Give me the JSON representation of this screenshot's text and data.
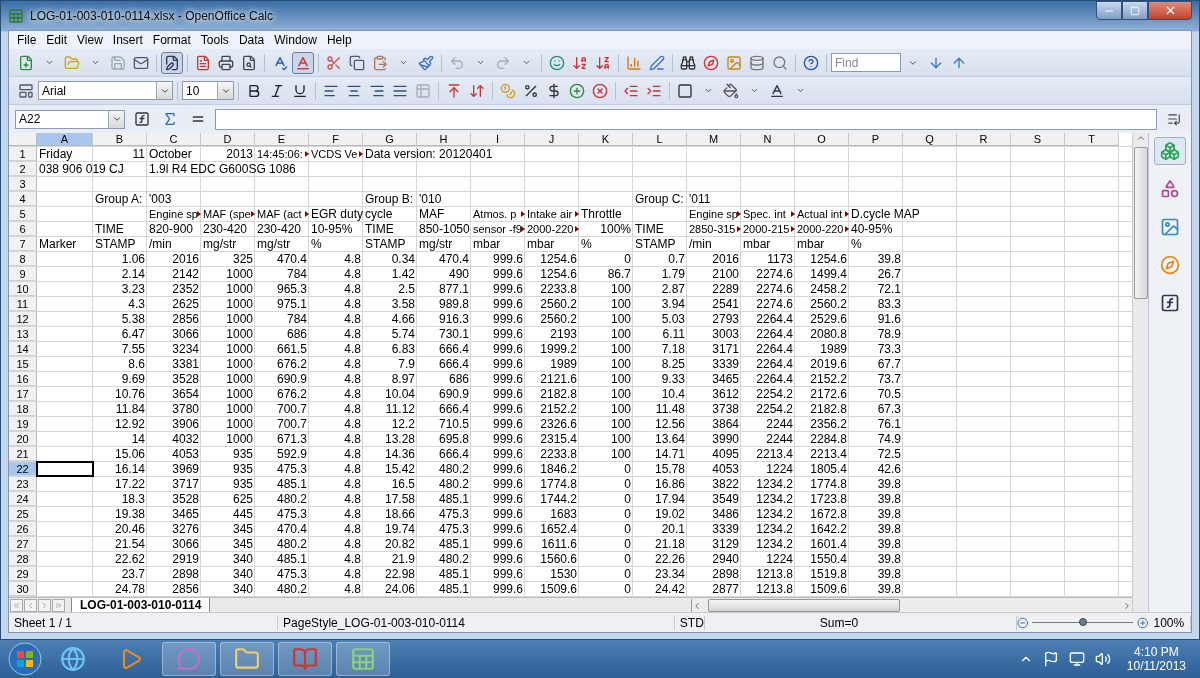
{
  "window": {
    "title": "LOG-01-003-010-0114.xlsx - OpenOffice Calc"
  },
  "menu": [
    {
      "label": "File"
    },
    {
      "label": "Edit"
    },
    {
      "label": "View"
    },
    {
      "label": "Insert"
    },
    {
      "label": "Format"
    },
    {
      "label": "Tools"
    },
    {
      "label": "Data"
    },
    {
      "label": "Window"
    },
    {
      "label": "Help"
    }
  ],
  "find": {
    "placeholder": "Find"
  },
  "formatting": {
    "font": "Arial",
    "size": "10"
  },
  "formula_bar": {
    "name_box": "A22"
  },
  "columns": [
    {
      "label": "A",
      "selected": true
    },
    {
      "label": "B",
      "selected": false
    },
    {
      "label": "C",
      "selected": false
    },
    {
      "label": "D",
      "selected": false
    },
    {
      "label": "E",
      "selected": false
    },
    {
      "label": "F",
      "selected": false
    },
    {
      "label": "G",
      "selected": false
    },
    {
      "label": "H",
      "selected": false
    },
    {
      "label": "I",
      "selected": false
    },
    {
      "label": "J",
      "selected": false
    },
    {
      "label": "K",
      "selected": false
    },
    {
      "label": "L",
      "selected": false
    },
    {
      "label": "M",
      "selected": false
    },
    {
      "label": "N",
      "selected": false
    },
    {
      "label": "O",
      "selected": false
    },
    {
      "label": "P",
      "selected": false
    },
    {
      "label": "Q",
      "selected": false
    },
    {
      "label": "R",
      "selected": false
    },
    {
      "label": "S",
      "selected": false
    },
    {
      "label": "T",
      "selected": false
    }
  ],
  "header_rows": [
    {
      "number": "1",
      "selected": false,
      "cells": [
        {
          "kind": "text",
          "text": "Friday"
        },
        {
          "kind": "number",
          "text": "11"
        },
        {
          "kind": "text",
          "text": "October"
        },
        {
          "kind": "number",
          "text": "2013"
        },
        {
          "kind": "clipped",
          "text": "14:45:06:"
        },
        {
          "kind": "clipped",
          "text": "VCDS Ve"
        },
        {
          "kind": "text",
          "text": "Data version: 20120401"
        }
      ]
    },
    {
      "number": "2",
      "selected": false,
      "cells": [
        {
          "kind": "text",
          "text": "038 906 019 CJ"
        },
        {
          "kind": "blank"
        },
        {
          "kind": "text",
          "text": "1.9l R4 EDC G600SG  1086"
        }
      ]
    },
    {
      "number": "3",
      "selected": false,
      "cells": []
    },
    {
      "number": "4",
      "selected": false,
      "cells": [
        {
          "kind": "blank"
        },
        {
          "kind": "text",
          "text": "Group A:"
        },
        {
          "kind": "text",
          "text": "'003"
        },
        {
          "kind": "blank"
        },
        {
          "kind": "blank"
        },
        {
          "kind": "blank"
        },
        {
          "kind": "text",
          "text": "Group B:"
        },
        {
          "kind": "text",
          "text": "'010"
        },
        {
          "kind": "blank"
        },
        {
          "kind": "blank"
        },
        {
          "kind": "blank"
        },
        {
          "kind": "text",
          "text": "Group C:"
        },
        {
          "kind": "text",
          "text": "'011"
        }
      ]
    },
    {
      "number": "5",
      "selected": false,
      "cells": [
        {
          "kind": "blank"
        },
        {
          "kind": "blank"
        },
        {
          "kind": "clipped",
          "text": "Engine sp"
        },
        {
          "kind": "clipped",
          "text": "MAF (spe"
        },
        {
          "kind": "clipped",
          "text": "MAF (act"
        },
        {
          "kind": "text",
          "text": "EGR duty"
        },
        {
          "kind": "text",
          "text": "cycle"
        },
        {
          "kind": "text",
          "text": "MAF"
        },
        {
          "kind": "clipped",
          "text": "Atmos. p"
        },
        {
          "kind": "clipped",
          "text": "Intake air"
        },
        {
          "kind": "text",
          "text": "Throttle"
        },
        {
          "kind": "blank"
        },
        {
          "kind": "clipped",
          "text": "Engine sp"
        },
        {
          "kind": "clipped",
          "text": "Spec. int"
        },
        {
          "kind": "clipped",
          "text": "Actual int"
        },
        {
          "kind": "text",
          "text": "D.cycle MAP"
        }
      ]
    },
    {
      "number": "6",
      "selected": false,
      "cells": [
        {
          "kind": "blank"
        },
        {
          "kind": "text",
          "text": "TIME"
        },
        {
          "kind": "text",
          "text": "820-900"
        },
        {
          "kind": "text",
          "text": "230-420"
        },
        {
          "kind": "text",
          "text": "230-420"
        },
        {
          "kind": "text",
          "text": "10-95%"
        },
        {
          "kind": "text",
          "text": "TIME"
        },
        {
          "kind": "text",
          "text": "850-1050"
        },
        {
          "kind": "clipped",
          "text": "sensor -f9"
        },
        {
          "kind": "clipped",
          "text": "2000-220"
        },
        {
          "kind": "number",
          "text": "100%"
        },
        {
          "kind": "text",
          "text": "TIME"
        },
        {
          "kind": "clipped",
          "text": "2850-315"
        },
        {
          "kind": "clipped",
          "text": "2000-215"
        },
        {
          "kind": "clipped",
          "text": "2000-220"
        },
        {
          "kind": "text",
          "text": "40-95%"
        }
      ]
    },
    {
      "number": "7",
      "selected": false,
      "cells": [
        {
          "kind": "text",
          "text": "Marker"
        },
        {
          "kind": "text",
          "text": "STAMP"
        },
        {
          "kind": "text",
          "text": "/min"
        },
        {
          "kind": "text",
          "text": "mg/str"
        },
        {
          "kind": "text",
          "text": "mg/str"
        },
        {
          "kind": "text",
          "text": "%"
        },
        {
          "kind": "text",
          "text": "STAMP"
        },
        {
          "kind": "text",
          "text": "mg/str"
        },
        {
          "kind": "text",
          "text": "mbar"
        },
        {
          "kind": "text",
          "text": "mbar"
        },
        {
          "kind": "text",
          "text": "%"
        },
        {
          "kind": "text",
          "text": "STAMP"
        },
        {
          "kind": "text",
          "text": "/min"
        },
        {
          "kind": "text",
          "text": "mbar"
        },
        {
          "kind": "text",
          "text": "mbar"
        },
        {
          "kind": "text",
          "text": "%"
        }
      ]
    }
  ],
  "data_rows": [
    {
      "number": "8",
      "selected": false,
      "values": [
        "1.06",
        "2016",
        "325",
        "470.4",
        "4.8",
        "0.34",
        "470.4",
        "999.6",
        "1254.6",
        "0",
        "0.7",
        "2016",
        "1173",
        "1254.6",
        "39.8"
      ]
    },
    {
      "number": "9",
      "selected": false,
      "values": [
        "2.14",
        "2142",
        "1000",
        "784",
        "4.8",
        "1.42",
        "490",
        "999.6",
        "1254.6",
        "86.7",
        "1.79",
        "2100",
        "2274.6",
        "1499.4",
        "26.7"
      ]
    },
    {
      "number": "10",
      "selected": false,
      "values": [
        "3.23",
        "2352",
        "1000",
        "965.3",
        "4.8",
        "2.5",
        "877.1",
        "999.6",
        "2233.8",
        "100",
        "2.87",
        "2289",
        "2274.6",
        "2458.2",
        "72.1"
      ]
    },
    {
      "number": "11",
      "selected": false,
      "values": [
        "4.3",
        "2625",
        "1000",
        "975.1",
        "4.8",
        "3.58",
        "989.8",
        "999.6",
        "2560.2",
        "100",
        "3.94",
        "2541",
        "2274.6",
        "2560.2",
        "83.3"
      ]
    },
    {
      "number": "12",
      "selected": false,
      "values": [
        "5.38",
        "2856",
        "1000",
        "784",
        "4.8",
        "4.66",
        "916.3",
        "999.6",
        "2560.2",
        "100",
        "5.03",
        "2793",
        "2264.4",
        "2529.6",
        "91.6"
      ]
    },
    {
      "number": "13",
      "selected": false,
      "values": [
        "6.47",
        "3066",
        "1000",
        "686",
        "4.8",
        "5.74",
        "730.1",
        "999.6",
        "2193",
        "100",
        "6.11",
        "3003",
        "2264.4",
        "2080.8",
        "78.9"
      ]
    },
    {
      "number": "14",
      "selected": false,
      "values": [
        "7.55",
        "3234",
        "1000",
        "661.5",
        "4.8",
        "6.83",
        "666.4",
        "999.6",
        "1999.2",
        "100",
        "7.18",
        "3171",
        "2264.4",
        "1989",
        "73.3"
      ]
    },
    {
      "number": "15",
      "selected": false,
      "values": [
        "8.6",
        "3381",
        "1000",
        "676.2",
        "4.8",
        "7.9",
        "666.4",
        "999.6",
        "1989",
        "100",
        "8.25",
        "3339",
        "2264.4",
        "2019.6",
        "67.7"
      ]
    },
    {
      "number": "16",
      "selected": false,
      "values": [
        "9.69",
        "3528",
        "1000",
        "690.9",
        "4.8",
        "8.97",
        "686",
        "999.6",
        "2121.6",
        "100",
        "9.33",
        "3465",
        "2264.4",
        "2152.2",
        "73.7"
      ]
    },
    {
      "number": "17",
      "selected": false,
      "values": [
        "10.76",
        "3654",
        "1000",
        "676.2",
        "4.8",
        "10.04",
        "690.9",
        "999.6",
        "2182.8",
        "100",
        "10.4",
        "3612",
        "2254.2",
        "2172.6",
        "70.5"
      ]
    },
    {
      "number": "18",
      "selected": false,
      "values": [
        "11.84",
        "3780",
        "1000",
        "700.7",
        "4.8",
        "11.12",
        "666.4",
        "999.6",
        "2152.2",
        "100",
        "11.48",
        "3738",
        "2254.2",
        "2182.8",
        "67.3"
      ]
    },
    {
      "number": "19",
      "selected": false,
      "values": [
        "12.92",
        "3906",
        "1000",
        "700.7",
        "4.8",
        "12.2",
        "710.5",
        "999.6",
        "2326.6",
        "100",
        "12.56",
        "3864",
        "2244",
        "2356.2",
        "76.1"
      ]
    },
    {
      "number": "20",
      "selected": false,
      "values": [
        "14",
        "4032",
        "1000",
        "671.3",
        "4.8",
        "13.28",
        "695.8",
        "999.6",
        "2315.4",
        "100",
        "13.64",
        "3990",
        "2244",
        "2284.8",
        "74.9"
      ]
    },
    {
      "number": "21",
      "selected": false,
      "values": [
        "15.06",
        "4053",
        "935",
        "592.9",
        "4.8",
        "14.36",
        "666.4",
        "999.6",
        "2233.8",
        "100",
        "14.71",
        "4095",
        "2213.4",
        "2213.4",
        "72.5"
      ]
    },
    {
      "number": "22",
      "selected": true,
      "values": [
        "16.14",
        "3969",
        "935",
        "475.3",
        "4.8",
        "15.42",
        "480.2",
        "999.6",
        "1846.2",
        "0",
        "15.78",
        "4053",
        "1224",
        "1805.4",
        "42.6"
      ]
    },
    {
      "number": "23",
      "selected": false,
      "values": [
        "17.22",
        "3717",
        "935",
        "485.1",
        "4.8",
        "16.5",
        "480.2",
        "999.6",
        "1774.8",
        "0",
        "16.86",
        "3822",
        "1234.2",
        "1774.8",
        "39.8"
      ]
    },
    {
      "number": "24",
      "selected": false,
      "values": [
        "18.3",
        "3528",
        "625",
        "480.2",
        "4.8",
        "17.58",
        "485.1",
        "999.6",
        "1744.2",
        "0",
        "17.94",
        "3549",
        "1234.2",
        "1723.8",
        "39.8"
      ]
    },
    {
      "number": "25",
      "selected": false,
      "values": [
        "19.38",
        "3465",
        "445",
        "475.3",
        "4.8",
        "18.66",
        "475.3",
        "999.6",
        "1683",
        "0",
        "19.02",
        "3486",
        "1234.2",
        "1672.8",
        "39.8"
      ]
    },
    {
      "number": "26",
      "selected": false,
      "values": [
        "20.46",
        "3276",
        "345",
        "470.4",
        "4.8",
        "19.74",
        "475.3",
        "999.6",
        "1652.4",
        "0",
        "20.1",
        "3339",
        "1234.2",
        "1642.2",
        "39.8"
      ]
    },
    {
      "number": "27",
      "selected": false,
      "values": [
        "21.54",
        "3066",
        "345",
        "480.2",
        "4.8",
        "20.82",
        "485.1",
        "999.6",
        "1611.6",
        "0",
        "21.18",
        "3129",
        "1234.2",
        "1601.4",
        "39.8"
      ]
    },
    {
      "number": "28",
      "selected": false,
      "values": [
        "22.62",
        "2919",
        "340",
        "485.1",
        "4.8",
        "21.9",
        "480.2",
        "999.6",
        "1560.6",
        "0",
        "22.26",
        "2940",
        "1224",
        "1550.4",
        "39.8"
      ]
    },
    {
      "number": "29",
      "selected": false,
      "values": [
        "23.7",
        "2898",
        "340",
        "475.3",
        "4.8",
        "22.98",
        "485.1",
        "999.6",
        "1530",
        "0",
        "23.34",
        "2898",
        "1213.8",
        "1519.8",
        "39.8"
      ]
    },
    {
      "number": "30",
      "selected": false,
      "values": [
        "24.78",
        "2856",
        "340",
        "480.2",
        "4.8",
        "24.06",
        "485.1",
        "999.6",
        "1509.6",
        "0",
        "24.42",
        "2877",
        "1213.8",
        "1509.6",
        "39.8"
      ]
    }
  ],
  "sheet_tabs": [
    {
      "label": "LOG-01-003-010-0114",
      "selected": true
    }
  ],
  "status_bar": {
    "sheet": "Sheet 1 / 1",
    "page_style": "PageStyle_LOG-01-003-010-0114",
    "mode": "STD",
    "sum": "Sum=0",
    "zoom": {
      "level": 0.5,
      "reading": "100%"
    }
  },
  "taskbar": {
    "time": "4:10 PM",
    "date": "10/11/2013"
  }
}
